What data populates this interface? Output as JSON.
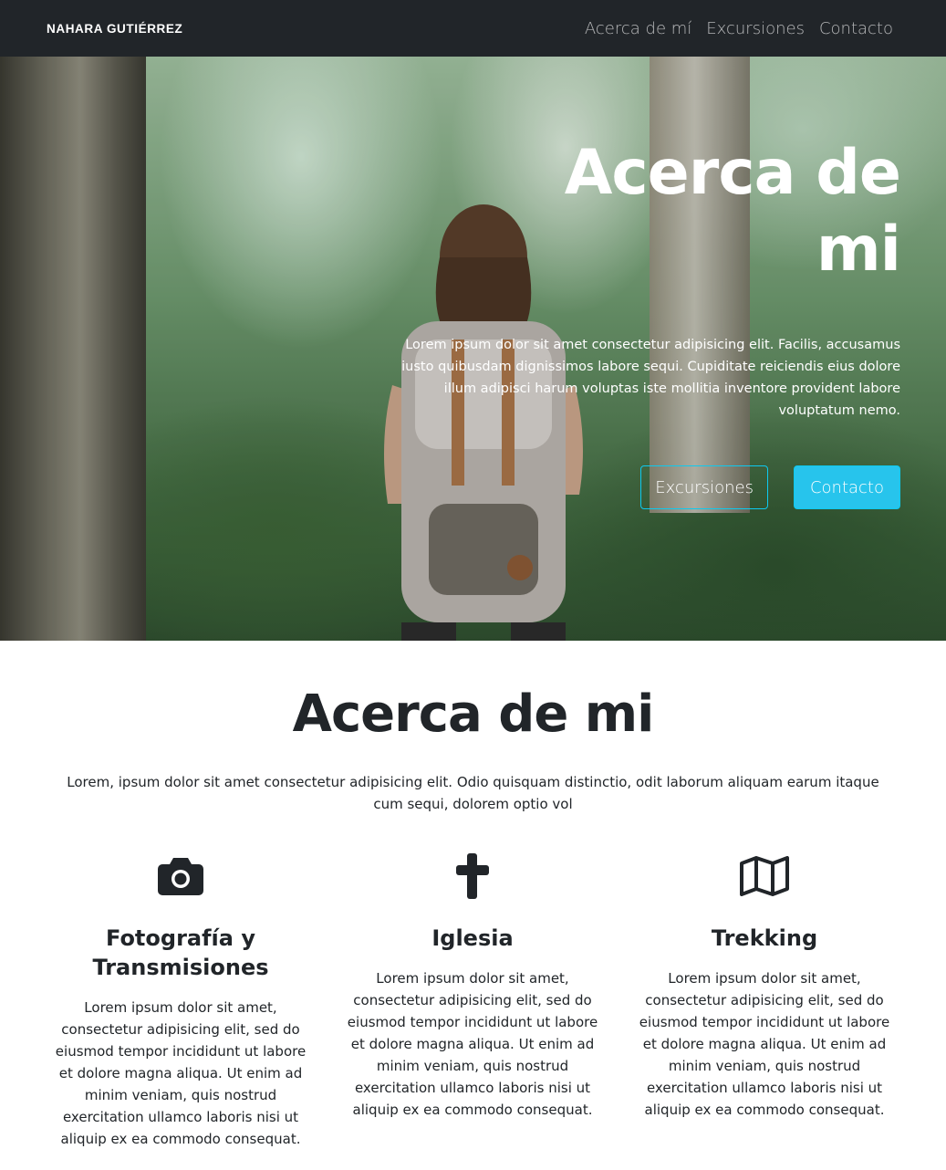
{
  "navbar": {
    "brand": "NAHARA GUTIÉRREZ",
    "links": [
      "Acerca de mí",
      "Excursiones",
      "Contacto"
    ]
  },
  "hero": {
    "title": "Acerca de mi",
    "text": "Lorem ipsum dolor sit amet consectetur adipisicing elit. Facilis, accusamus iusto quibusdam dignissimos labore sequi. Cupiditate reiciendis eius dolore illum adipisci harum voluptas iste mollitia inventore provident labore voluptatum nemo.",
    "buttons": {
      "excursiones": "Excursiones",
      "contacto": "Contacto"
    }
  },
  "about": {
    "title": "Acerca de mi",
    "text": "Lorem, ipsum dolor sit amet consectetur adipisicing elit. Odio quisquam distinctio, odit laborum aliquam earum itaque cum sequi, dolorem optio vol"
  },
  "features": [
    {
      "icon": "camera-icon",
      "title": "Fotografía y Transmisiones",
      "text": "Lorem ipsum dolor sit amet, consectetur adipisicing elit, sed do eiusmod tempor incididunt ut labore et dolore magna aliqua. Ut enim ad minim veniam, quis nostrud exercitation ullamco laboris nisi ut aliquip ex ea commodo consequat."
    },
    {
      "icon": "cross-icon",
      "title": "Iglesia",
      "text": "Lorem ipsum dolor sit amet, consectetur adipisicing elit, sed do eiusmod tempor incididunt ut labore et dolore magna aliqua. Ut enim ad minim veniam, quis nostrud exercitation ullamco laboris nisi ut aliquip ex ea commodo consequat."
    },
    {
      "icon": "map-icon",
      "title": "Trekking",
      "text": "Lorem ipsum dolor sit amet, consectetur adipisicing elit, sed do eiusmod tempor incididunt ut labore et dolore magna aliqua. Ut enim ad minim veniam, quis nostrud exercitation ullamco laboris nisi ut aliquip ex ea commodo consequat."
    }
  ],
  "colors": {
    "navbar_bg": "#212529",
    "accent": "#0dcaf0",
    "text": "#212529"
  }
}
